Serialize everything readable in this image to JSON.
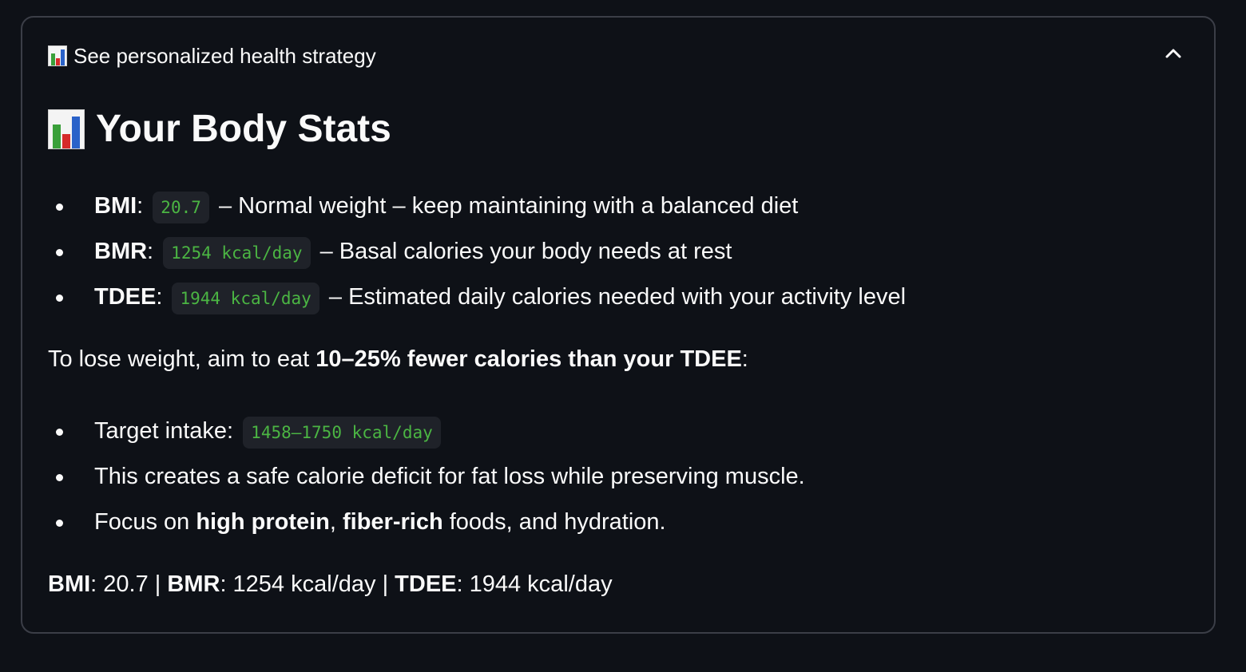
{
  "expander": {
    "label": "See personalized health strategy",
    "icon": "bar-chart-icon",
    "toggle_icon": "chevron-up-icon"
  },
  "heading": "Your Body Stats",
  "stats": [
    {
      "label": "BMI",
      "value": "20.7",
      "desc": "– Normal weight – keep maintaining with a balanced diet"
    },
    {
      "label": "BMR",
      "value": "1254 kcal/day",
      "desc": "– Basal calories your body needs at rest"
    },
    {
      "label": "TDEE",
      "value": "1944 kcal/day",
      "desc": "– Estimated daily calories needed with your activity level"
    }
  ],
  "advice": {
    "prefix": "To lose weight, aim to eat ",
    "bold": "10–25% fewer calories than your TDEE",
    "suffix": ":"
  },
  "tips": {
    "target_label": "Target intake:",
    "target_value": "1458–1750 kcal/day",
    "deficit": "This creates a safe calorie deficit for fat loss while preserving muscle.",
    "focus_prefix": "Focus on ",
    "focus_bold1": "high protein",
    "focus_sep": ", ",
    "focus_bold2": "fiber-rich",
    "focus_suffix": " foods, and hydration."
  },
  "summary": {
    "bmi_label": "BMI",
    "bmi_value": ": 20.7 | ",
    "bmr_label": "BMR",
    "bmr_value": ": 1254 kcal/day | ",
    "tdee_label": "TDEE",
    "tdee_value": ": 1944 kcal/day"
  },
  "colors": {
    "background": "#0e1117",
    "code_text": "#4bb543",
    "code_bg": "#1f2229",
    "border": "#3b3e47"
  }
}
